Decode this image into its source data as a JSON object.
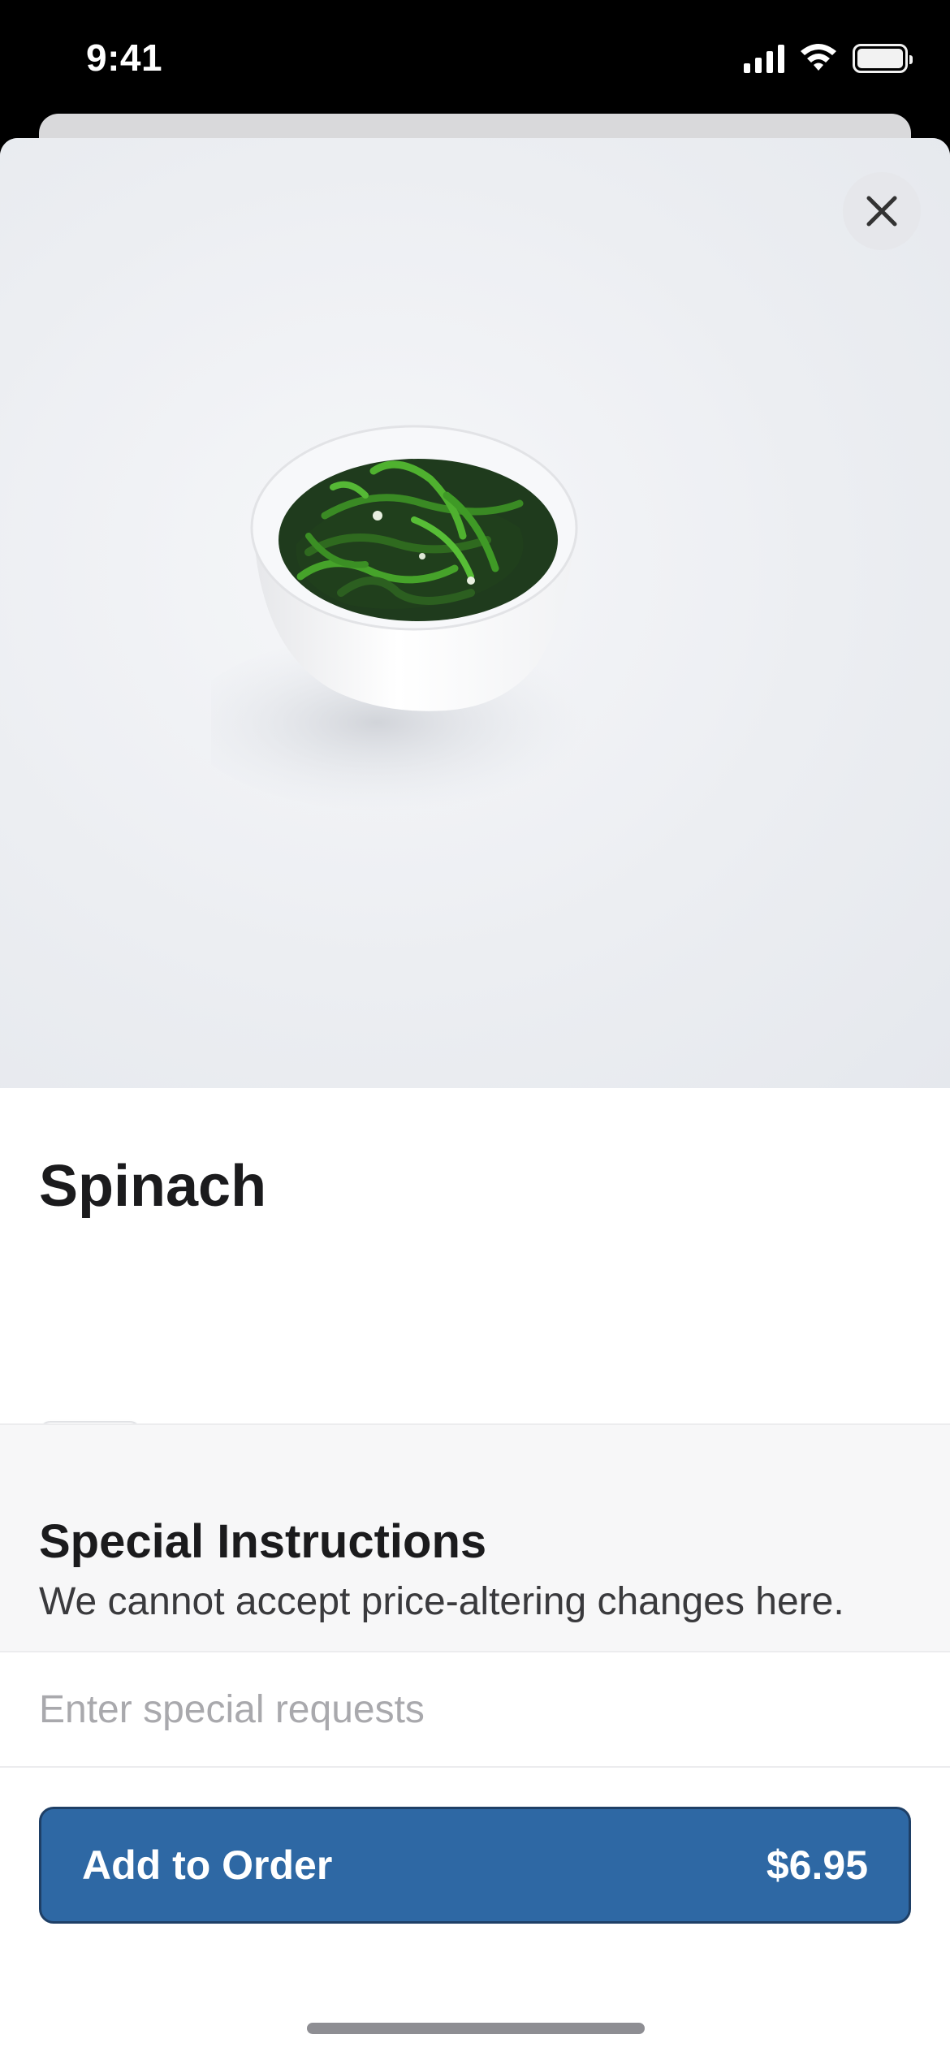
{
  "status_bar": {
    "time": "9:41"
  },
  "item": {
    "title": "Spinach",
    "image_icon": "spinach-bowl-photo"
  },
  "actions": {
    "close_icon": "close-icon",
    "favorite_icon": "heart-icon"
  },
  "special_instructions": {
    "title": "Special Instructions",
    "subtitle": "We cannot accept price-altering changes here.",
    "placeholder": "Enter special requests",
    "value": ""
  },
  "order_button": {
    "label": "Add to Order",
    "price": "$6.95"
  },
  "colors": {
    "accent": "#2e68a4",
    "accent_border": "#1e3f66"
  }
}
